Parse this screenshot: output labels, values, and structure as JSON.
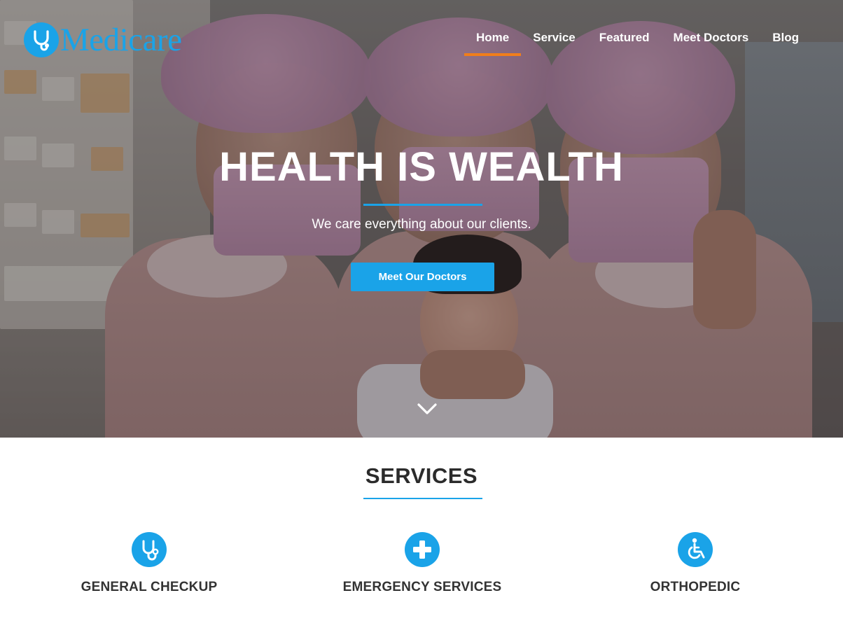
{
  "brand": {
    "name": "Medicare",
    "icon": "stethoscope-icon",
    "color": "#1aa3e8"
  },
  "nav": {
    "items": [
      {
        "label": "Home",
        "active": true
      },
      {
        "label": "Service",
        "active": false
      },
      {
        "label": "Featured",
        "active": false
      },
      {
        "label": "Meet Doctors",
        "active": false
      },
      {
        "label": "Blog",
        "active": false
      }
    ],
    "active_indicator_color": "#f07e1b"
  },
  "hero": {
    "title": "HEALTH IS WEALTH",
    "subtitle": "We care everything about our clients.",
    "cta_label": "Meet Our Doctors",
    "scroll_icon": "chevron-down-icon"
  },
  "services": {
    "title": "SERVICES",
    "items": [
      {
        "label": "GENERAL CHECKUP",
        "icon": "stethoscope-icon"
      },
      {
        "label": "EMERGENCY SERVICES",
        "icon": "plus-icon"
      },
      {
        "label": "ORTHOPEDIC",
        "icon": "wheelchair-icon"
      }
    ]
  },
  "colors": {
    "accent": "#1aa3e8",
    "highlight": "#f07e1b",
    "heading": "#2b2b2b"
  }
}
